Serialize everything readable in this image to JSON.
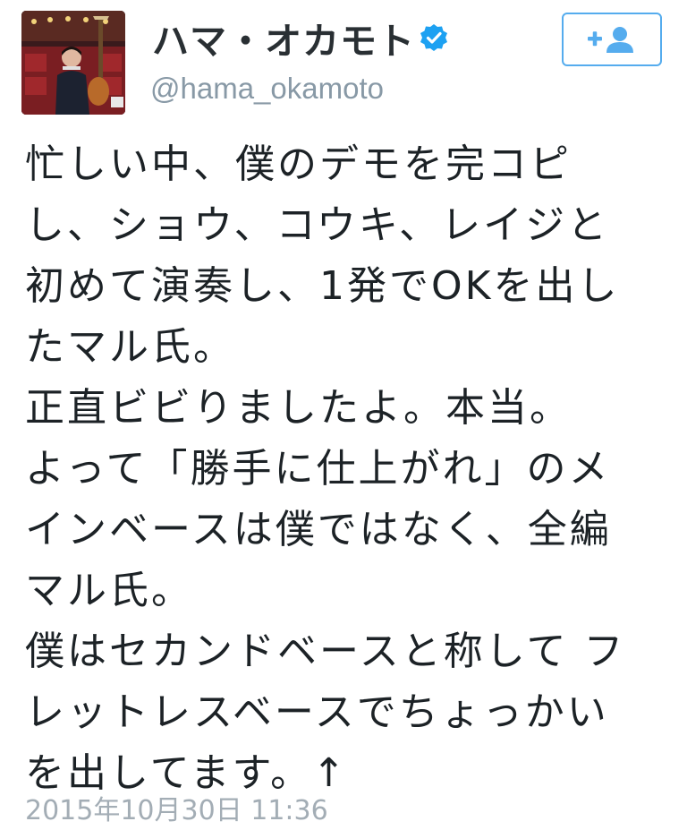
{
  "user": {
    "display_name": "ハマ・オカモト",
    "handle": "@hama_okamoto",
    "verified": true,
    "avatar_icon": "profile-photo"
  },
  "follow_button": {
    "icon": "add-user-icon",
    "accent_color": "#55acee"
  },
  "tweet": {
    "lines": [
      "忙しい中、僕のデモを完コピ",
      "し、ショウ、コウキ、レイジと",
      "初めて演奏し、1発でOKを出し",
      "たマル氏。",
      "正直ビビりましたよ。本当。",
      "よって「勝手に仕上がれ」のメ",
      "インベースは僕ではなく、全編",
      "マル氏。",
      "僕はセカンドベースと称して フ",
      "レットレスベースでちょっかい",
      "を出してます。↑"
    ],
    "timestamp": "2015年10月30日 11:36"
  }
}
